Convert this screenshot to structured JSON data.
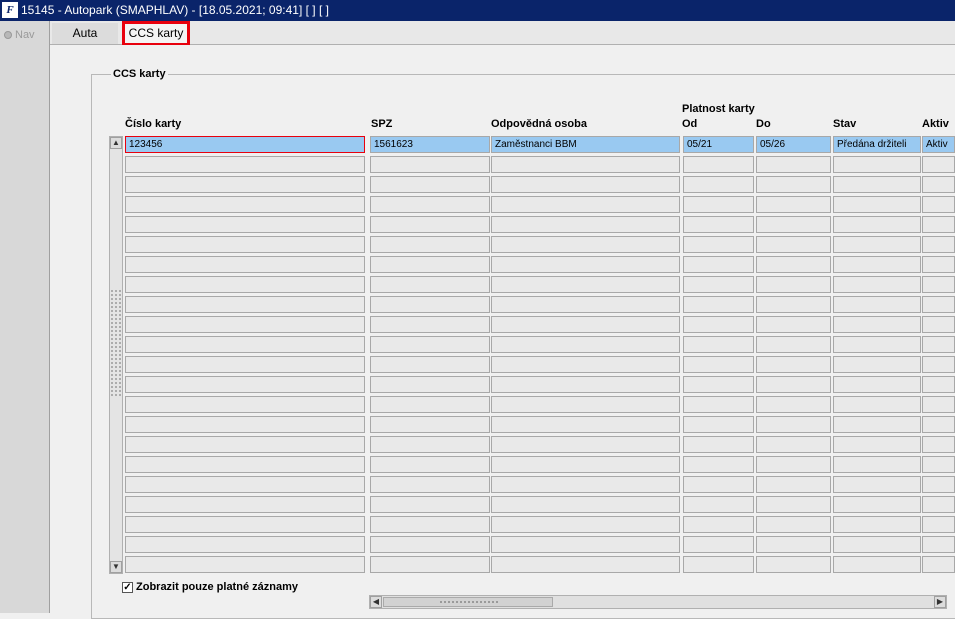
{
  "window": {
    "title": "15145 - Autopark (SMAPHLAV) - [18.05.2021; 09:41]  [ ]  [ ]",
    "icon": "oracle-forms-icon"
  },
  "nav": {
    "label": "Nav"
  },
  "tabs": [
    {
      "label": "Auta"
    },
    {
      "label": "CCS karty"
    }
  ],
  "group": {
    "title": "CCS karty"
  },
  "table": {
    "group_header": "Platnost karty",
    "columns": [
      "Číslo karty",
      "SPZ",
      "Odpovědná osoba",
      "Od",
      "Do",
      "Stav",
      "Aktiv"
    ],
    "rows": [
      [
        "123456",
        "1561623",
        "Zaměstnanci BBM",
        "05/21",
        "05/26",
        "Předána držiteli",
        "Aktiv"
      ]
    ]
  },
  "filter": {
    "checkbox_label": "Zobrazit pouze platné záznamy",
    "checked": true
  },
  "colors": {
    "titlebar": "#0a246a",
    "selected_row": "#99c9f1",
    "highlight": "#e8000d"
  }
}
